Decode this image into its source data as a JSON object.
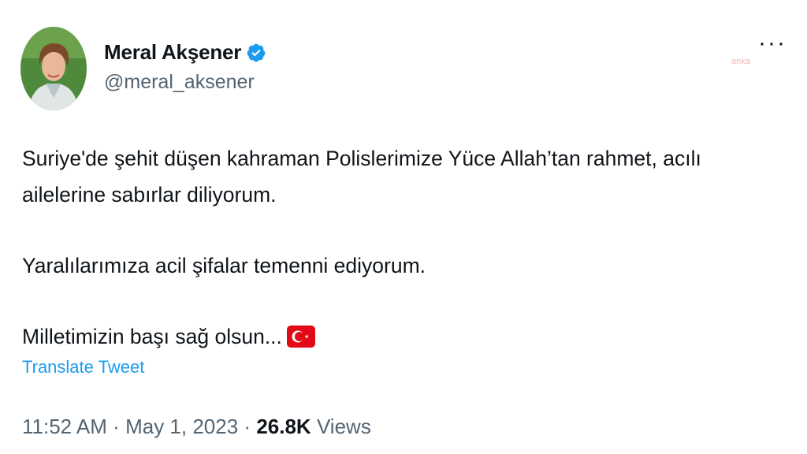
{
  "author": {
    "display_name": "Meral Akşener",
    "handle": "@meral_aksener",
    "verified": true,
    "avatar_icon": "profile-photo"
  },
  "watermark": "anka",
  "tweet": {
    "paragraphs": [
      "Suriye'de şehit düşen kahraman Polislerimize Yüce Allah’tan rahmet, acılı ailelerine sabırlar diliyorum.",
      "Yaralılarımıza acil şifalar temenni ediyorum.",
      "Milletimizin başı sağ olsun..."
    ],
    "emoji_icon": "turkey-flag",
    "translate_label": "Translate Tweet"
  },
  "meta": {
    "time": "11:52 AM",
    "separator": "·",
    "date": "May 1, 2023",
    "views_count": "26.8K",
    "views_label": "Views"
  },
  "more_label": "···",
  "colors": {
    "accent": "#1d9bf0",
    "text": "#0f1419",
    "secondary": "#536471",
    "flag_red": "#e30a17"
  }
}
